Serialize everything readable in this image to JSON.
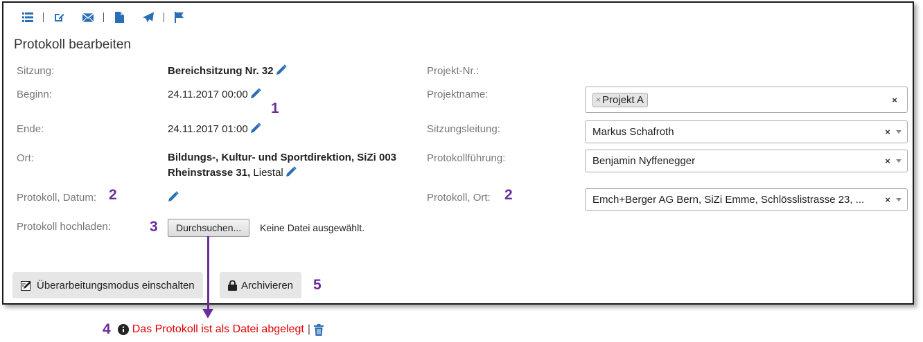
{
  "toolbar": {
    "icons": [
      "list-icon",
      "edit-icon",
      "envelope-icon",
      "file-icon",
      "send-icon",
      "flag-icon"
    ],
    "icon_color": "#2a6fb5"
  },
  "form": {
    "title": "Protokoll bearbeiten",
    "sitzung": {
      "label": "Sitzung:",
      "value": "Bereichsitzung Nr. 32"
    },
    "beginn": {
      "label": "Beginn:",
      "value": "24.11.2017 00:00"
    },
    "ende": {
      "label": "Ende:",
      "value": "24.11.2017 01:00"
    },
    "ort": {
      "label": "Ort:",
      "value_line1": "Bildungs-, Kultur- und Sportdirektion, SiZi 003",
      "value_line2_bold": "Rheinstrasse 31,",
      "value_line2_rest": " Liestal"
    },
    "protokoll_datum": {
      "label": "Protokoll, Datum:"
    },
    "protokoll_hochladen": {
      "label": "Protokoll hochladen:",
      "button": "Durchsuchen...",
      "status": "Keine Datei ausgewählt."
    },
    "projekt_nr": {
      "label": "Projekt-Nr.:"
    },
    "projektname": {
      "label": "Projektname:",
      "chip": "Projekt A",
      "chip_remove": "×",
      "clear": "×"
    },
    "sitzungsleitung": {
      "label": "Sitzungsleitung:",
      "value": "Markus Schafroth",
      "clear": "×"
    },
    "protokollfuehrung": {
      "label": "Protokollführung:",
      "value": "Benjamin Nyffenegger",
      "clear": "×"
    },
    "protokoll_ort": {
      "label": "Protokoll, Ort:",
      "value": "Emch+Berger AG Bern, SiZi Emme, Schlösslistrasse 23, ...",
      "clear": "×"
    }
  },
  "buttons": {
    "revision": "Überarbeitungsmodus einschalten",
    "archive": "Archivieren"
  },
  "annotations": {
    "n1": "1",
    "n2a": "2",
    "n2b": "2",
    "n3": "3",
    "n4": "4",
    "n5": "5",
    "color": "#6a2d9b"
  },
  "status": {
    "message": "Das Protokoll ist als Datei abgelegt",
    "separator": "|",
    "color": "#e00000"
  }
}
